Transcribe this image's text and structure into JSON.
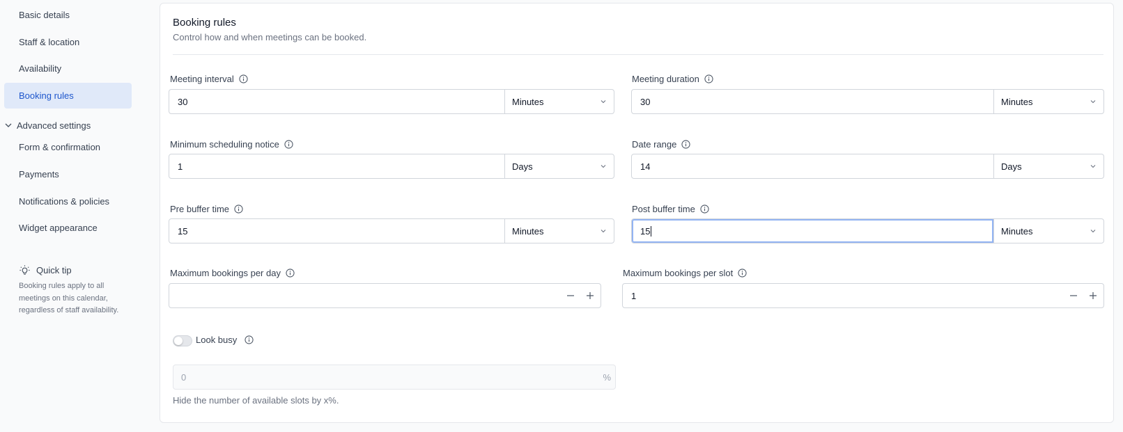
{
  "sidebar": {
    "items": [
      {
        "label": "Basic details"
      },
      {
        "label": "Staff & location"
      },
      {
        "label": "Availability"
      },
      {
        "label": "Booking rules"
      },
      {
        "label": "Form & confirmation"
      },
      {
        "label": "Payments"
      },
      {
        "label": "Notifications & policies"
      },
      {
        "label": "Widget appearance"
      }
    ],
    "group_label": "Advanced settings",
    "active_color": "#1d56cc",
    "tip": {
      "title": "Quick tip",
      "icon": "lightbulb-icon",
      "body": "Booking rules apply to all meetings on this calendar, regardless of staff availability."
    }
  },
  "card": {
    "title": "Booking rules",
    "subtitle": "Control how and when meetings can be booked."
  },
  "fields": {
    "meeting_interval": {
      "label": "Meeting interval",
      "value": "30",
      "unit": "Minutes"
    },
    "meeting_duration": {
      "label": "Meeting duration",
      "value": "30",
      "unit": "Minutes"
    },
    "min_notice": {
      "label": "Minimum scheduling notice",
      "value": "1",
      "unit": "Days"
    },
    "date_range": {
      "label": "Date range",
      "value": "14",
      "unit": "Days"
    },
    "pre_buffer": {
      "label": "Pre buffer time",
      "value": "15",
      "unit": "Minutes"
    },
    "post_buffer": {
      "label": "Post buffer time",
      "value": "15",
      "unit": "Minutes"
    },
    "max_per_day": {
      "label": "Maximum bookings per day",
      "value": ""
    },
    "max_per_slot": {
      "label": "Maximum bookings per slot",
      "value": "1"
    },
    "look_busy": {
      "label": "Look busy",
      "enabled": false,
      "placeholder": "0",
      "suffix": "%",
      "helper": "Hide the number of available slots by x%."
    }
  }
}
